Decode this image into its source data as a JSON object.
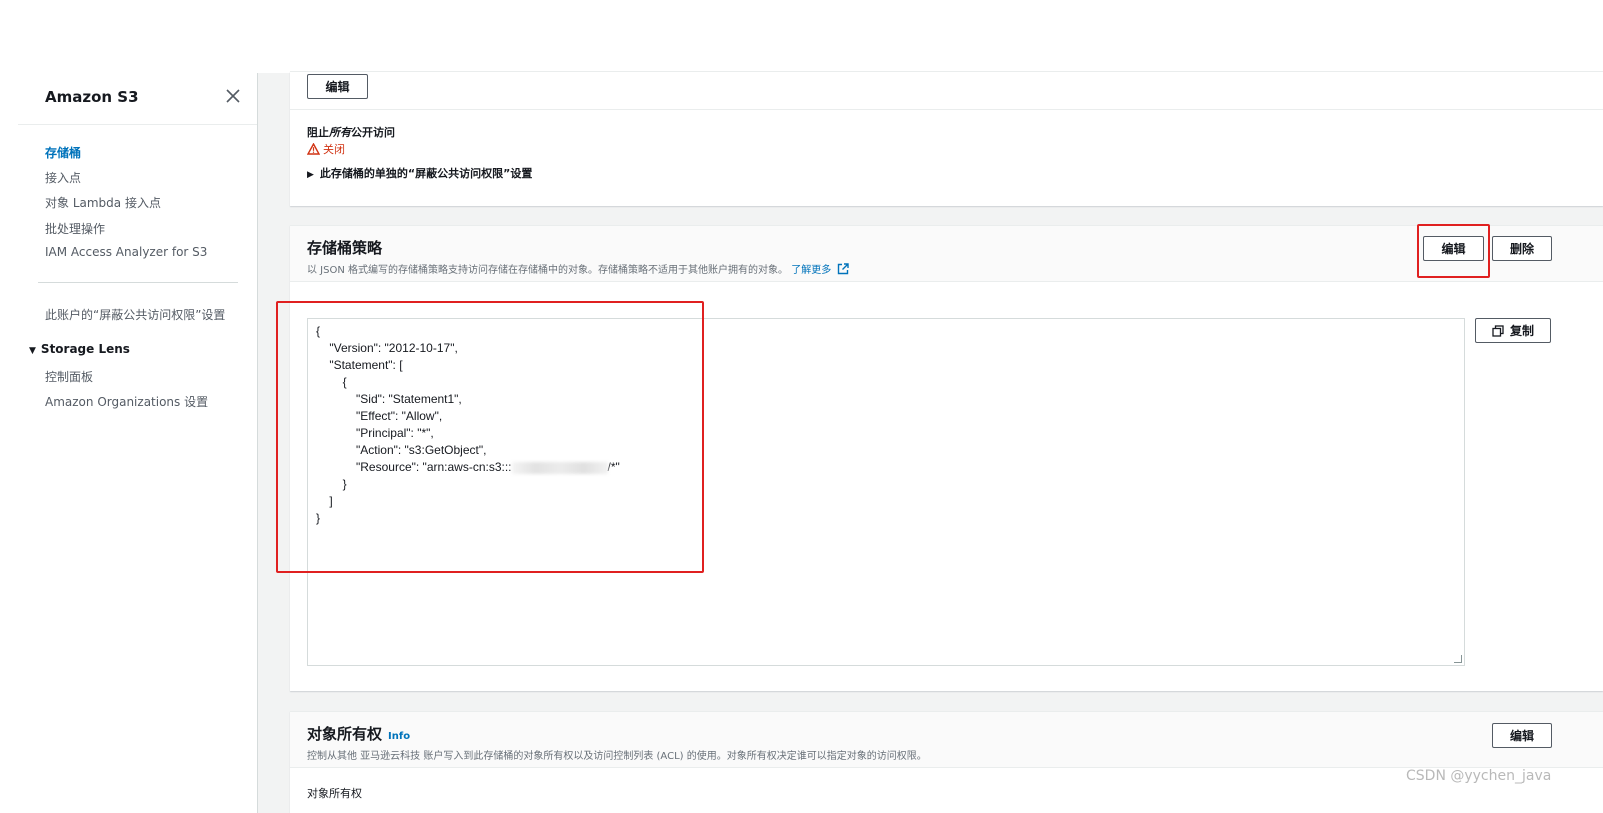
{
  "sidebar": {
    "title": "Amazon S3",
    "items": [
      {
        "label": "存储桶",
        "active": true
      },
      {
        "label": "接入点"
      },
      {
        "label": "对象 Lambda 接入点"
      },
      {
        "label": "批处理操作"
      },
      {
        "label": "IAM Access Analyzer for S3"
      }
    ],
    "account_block_setting": "此账户的“屏蔽公共访问权限”设置",
    "storage_lens": {
      "label": "Storage Lens",
      "items": [
        "控制面板",
        "Amazon Organizations 设置"
      ]
    }
  },
  "block_public_access": {
    "edit_label": "编辑",
    "label_prefix": "阻止",
    "label_em": "所有",
    "label_suffix": "公开访问",
    "status": "关闭",
    "expander": "此存储桶的单独的“屏蔽公共访问权限”设置"
  },
  "bucket_policy": {
    "title": "存储桶策略",
    "description": "以 JSON 格式编写的存储桶策略支持访问存储在存储桶中的对象。存储桶策略不适用于其他账户拥有的对象。",
    "learn_more": "了解更多",
    "edit_label": "编辑",
    "delete_label": "删除",
    "copy_label": "复制",
    "code_lines": [
      "{",
      "    \"Version\": \"2012-10-17\",",
      "    \"Statement\": [",
      "        {",
      "            \"Sid\": \"Statement1\",",
      "            \"Effect\": \"Allow\",",
      "            \"Principal\": \"*\",",
      "            \"Action\": \"s3:GetObject\","
    ],
    "resource_prefix": "            \"Resource\": \"arn:aws-cn:s3:::",
    "resource_suffix": "/*\"",
    "code_tail": [
      "        }",
      "    ]",
      "}"
    ]
  },
  "object_ownership": {
    "title": "对象所有权",
    "info": "Info",
    "description": "控制从其他 亚马逊云科技 账户写入到此存储桶的对象所有权以及访问控制列表 (ACL) 的使用。对象所有权决定谁可以指定对象的访问权限。",
    "edit_label": "编辑",
    "sub_label": "对象所有权"
  },
  "watermark": "CSDN @yychen_java",
  "colors": {
    "link": "#0073bb",
    "warning": "#d13212",
    "annotation": "#e02020"
  }
}
